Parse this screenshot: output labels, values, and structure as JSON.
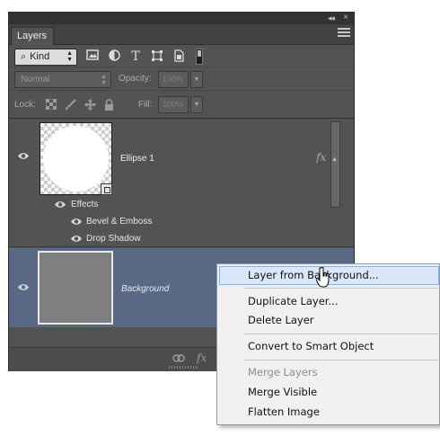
{
  "panel": {
    "title": "Layers",
    "collapse_glyph": "◂◂",
    "close_glyph": "×"
  },
  "filter": {
    "kind_label": "Kind",
    "icons": [
      "image-filter-icon",
      "adjustment-filter-icon",
      "type-filter-icon",
      "shape-filter-icon",
      "smart-object-filter-icon"
    ],
    "type_glyph": "T"
  },
  "blend": {
    "mode": "Normal",
    "opacity_label": "Opacity:",
    "opacity_value": "100%",
    "fill_label": "Fill:",
    "fill_value": "100%"
  },
  "lock": {
    "label": "Lock:",
    "icons": [
      "lock-transparent-pixels-icon",
      "lock-image-pixels-icon",
      "lock-position-icon",
      "lock-all-icon"
    ]
  },
  "layers": [
    {
      "name": "Ellipse 1",
      "fx": "fx",
      "effects_label": "Effects",
      "effects": [
        "Bevel & Emboss",
        "Drop Shadow"
      ]
    },
    {
      "name": "Background",
      "selected": true
    }
  ],
  "bottom_bar": {
    "fx": "fx"
  },
  "context_menu": {
    "items": [
      {
        "label": "Layer from Background...",
        "highlighted": true,
        "enabled": true
      },
      {
        "label": "Duplicate Layer...",
        "enabled": true
      },
      {
        "label": "Delete Layer",
        "enabled": true
      },
      {
        "label": "Convert to Smart Object",
        "enabled": true
      },
      {
        "label": "Merge Layers",
        "enabled": false
      },
      {
        "label": "Merge Visible",
        "enabled": true
      },
      {
        "label": "Flatten Image",
        "enabled": true
      }
    ]
  },
  "colors": {
    "panel_bg": "#535353",
    "selected_layer": "#5a6983",
    "menu_bg": "#f0f0f0",
    "menu_highlight": "#dbe7f6"
  }
}
